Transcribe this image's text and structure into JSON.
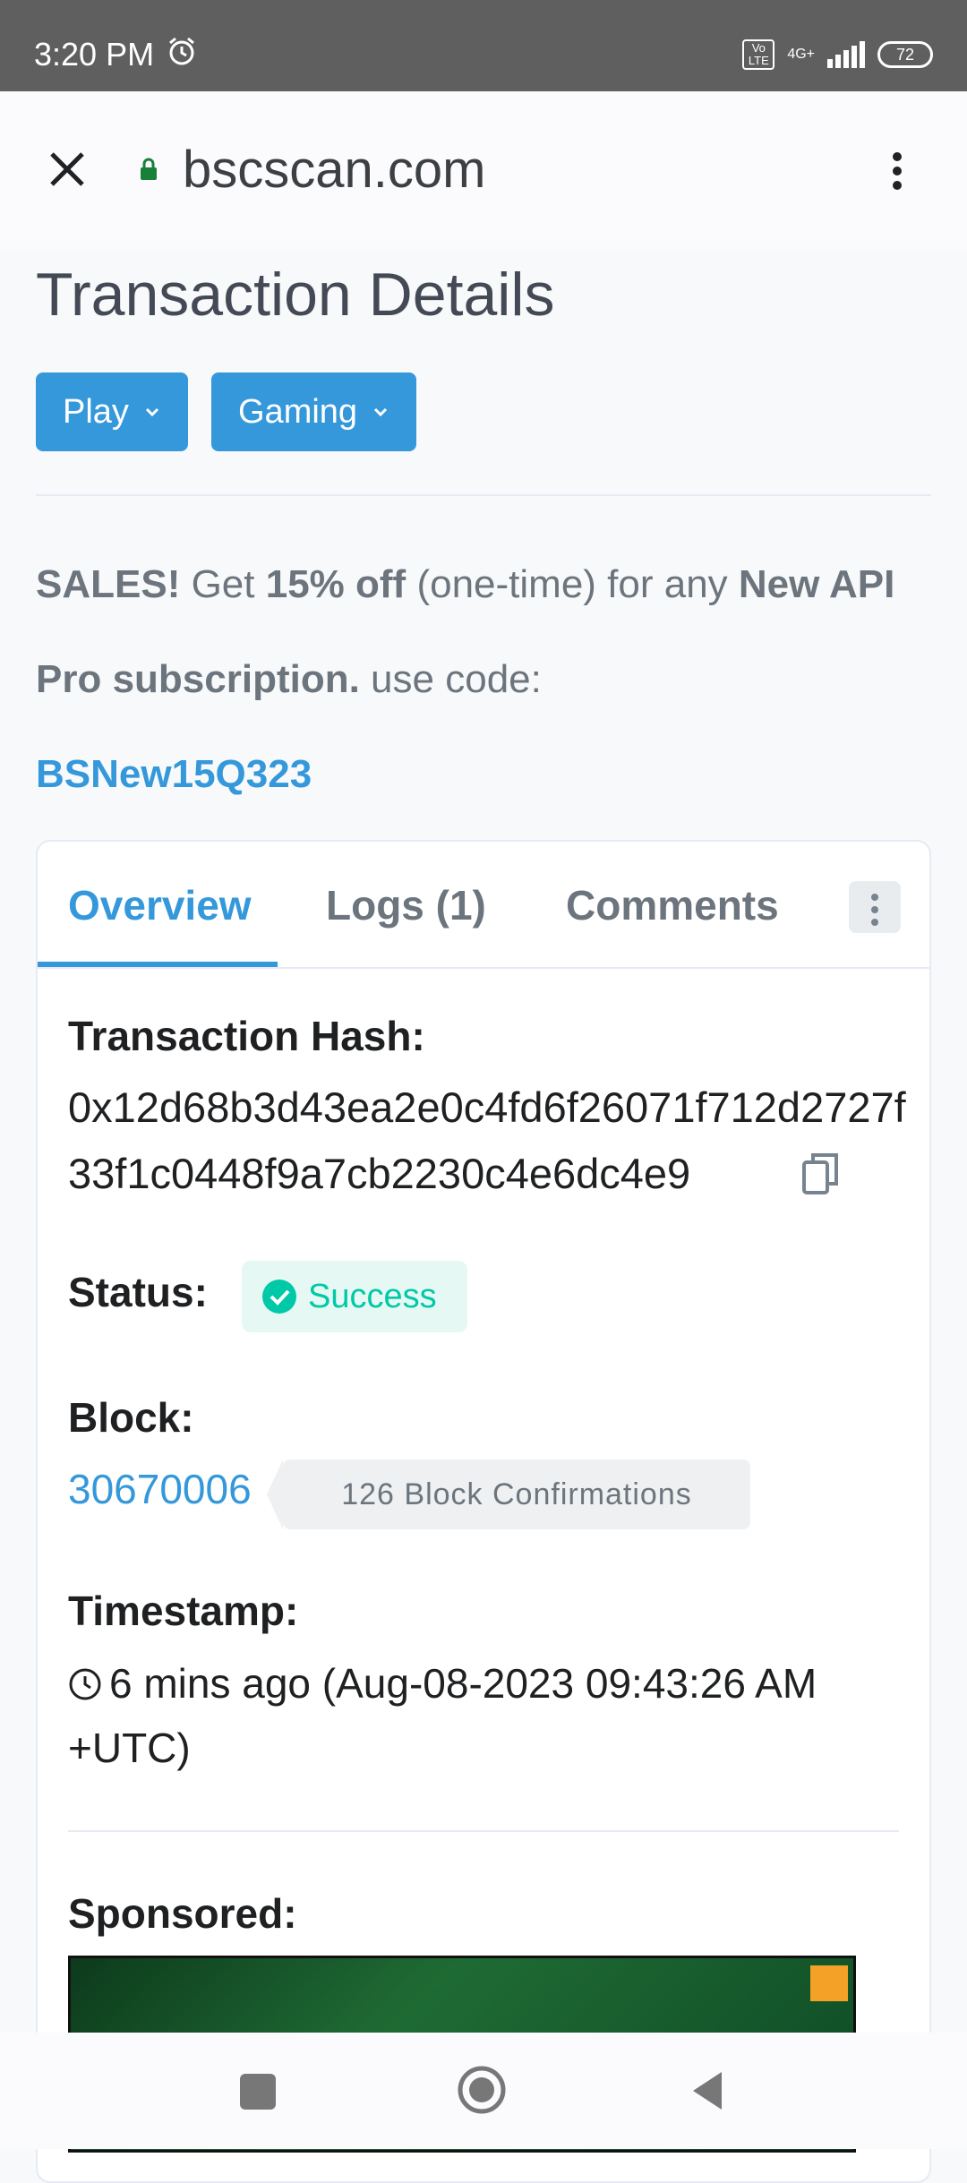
{
  "status_bar": {
    "time": "3:20 PM",
    "volte": "Vo LTE",
    "network": "4G+",
    "battery": "72"
  },
  "browser": {
    "url": "bscscan.com"
  },
  "page": {
    "title": "Transaction Details",
    "buttons": [
      {
        "label": "Play"
      },
      {
        "label": "Gaming"
      }
    ]
  },
  "promo": {
    "sales": "SALES!",
    "get": " Get ",
    "discount": "15% off",
    "one_time": " (one-time) for any ",
    "new": "New API Pro subscription.",
    "use_code": " use code:",
    "code": "BSNew15Q323"
  },
  "tabs": [
    {
      "label": "Overview"
    },
    {
      "label": "Logs (1)"
    },
    {
      "label": "Comments"
    }
  ],
  "overview": {
    "hash_label": "Transaction Hash:",
    "hash_value": "0x12d68b3d43ea2e0c4fd6f26071f712d2727f33f1c0448f9a7cb2230c4e6dc4e9",
    "status_label": "Status:",
    "status_value": "Success",
    "block_label": "Block:",
    "block_value": "30670006",
    "block_confirmations": "126 Block Confirmations",
    "timestamp_label": "Timestamp:",
    "timestamp_value": "6 mins ago (Aug-08-2023 09:43:26 AM +UTC)",
    "sponsored_label": "Sponsored:"
  },
  "colors": {
    "accent": "#3498db",
    "success": "#00c9a7",
    "status_bar": "#5f5f5f"
  }
}
